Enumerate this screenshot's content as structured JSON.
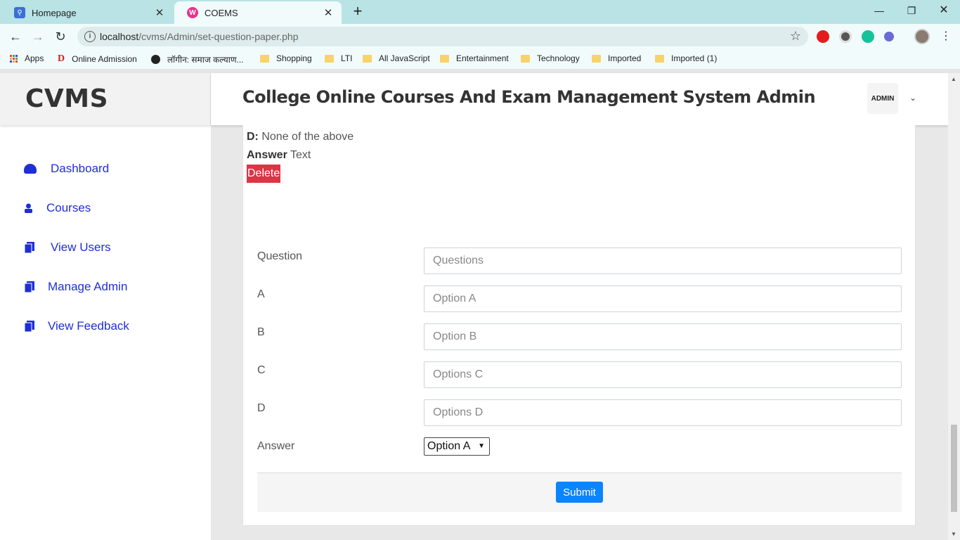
{
  "browser": {
    "tabs": [
      {
        "title": "Homepage",
        "active": false
      },
      {
        "title": "COEMS",
        "active": true
      }
    ],
    "url": "localhost/cvms/Admin/set-question-paper.php",
    "url_host": "localhost",
    "url_path": "/cvms/Admin/set-question-paper.php",
    "bookmarks": [
      "Apps",
      "Online Admission",
      "लॉगीन: समाज कल्याण...",
      "Shopping",
      "LTI",
      "All JavaScript",
      "Entertainment",
      "Technology",
      "Imported",
      "Imported (1)"
    ]
  },
  "sidebar": {
    "brand": "CVMS",
    "items": [
      {
        "label": "Dashboard",
        "icon": "dashboard-icon"
      },
      {
        "label": "Courses",
        "icon": "user-icon"
      },
      {
        "label": "View Users",
        "icon": "file-icon"
      },
      {
        "label": "Manage Admin",
        "icon": "file-icon"
      },
      {
        "label": "View Feedback",
        "icon": "file-icon"
      }
    ]
  },
  "header": {
    "title": "College Online Courses And Exam Management System Admin",
    "avatar_text": "ADMIN"
  },
  "question_preview": {
    "option_d_label": "D:",
    "option_d_text": "None of the above",
    "answer_label": "Answer",
    "answer_text": "Text",
    "delete_label": "Delete"
  },
  "form": {
    "question_label": "Question",
    "question_placeholder": "Questions",
    "a_label": "A",
    "a_placeholder": "Option A",
    "b_label": "B",
    "b_placeholder": "Option B",
    "c_label": "C",
    "c_placeholder": "Options C",
    "d_label": "D",
    "d_placeholder": "Options D",
    "answer_label": "Answer",
    "answer_selected": "Option A",
    "submit_label": "Submit"
  },
  "colors": {
    "tabbar": "#b9e3e5",
    "sidebar_link": "#1f2ed6",
    "delete": "#dc3545",
    "submit": "#0a84ff"
  }
}
